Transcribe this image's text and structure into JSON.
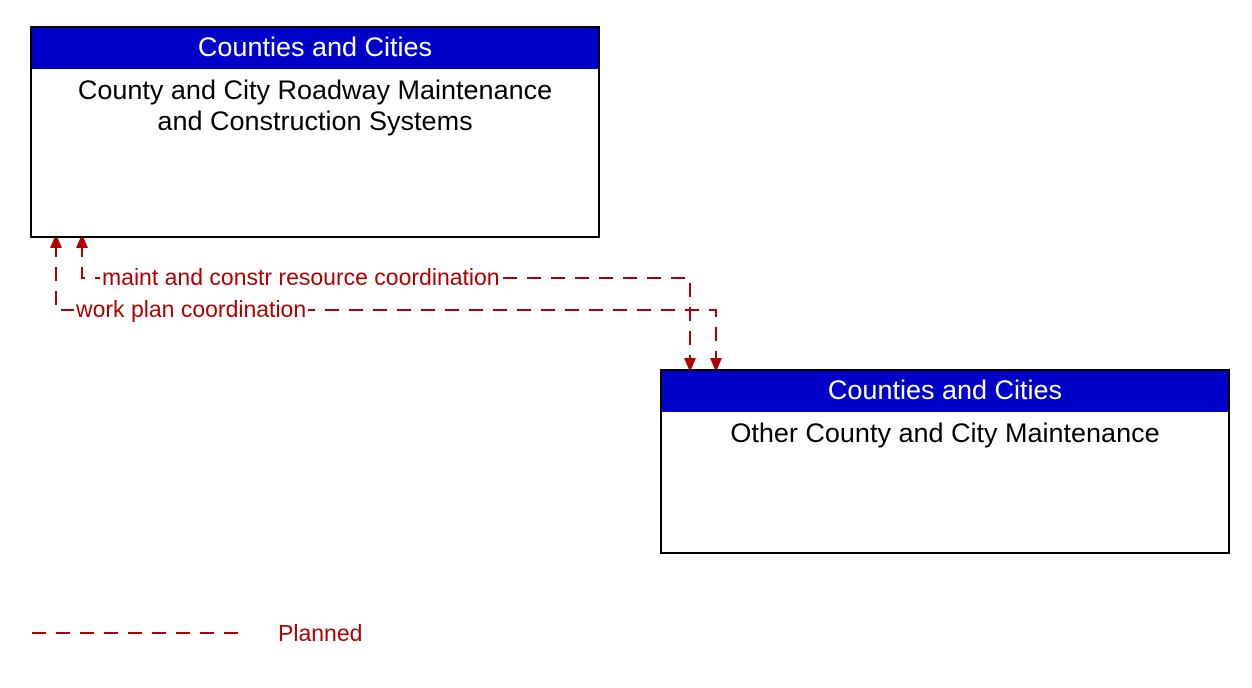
{
  "entities": {
    "top": {
      "header": "Counties and Cities",
      "body": "County and City Roadway Maintenance and Construction Systems"
    },
    "bottom": {
      "header": "Counties and Cities",
      "body": "Other County and City Maintenance"
    }
  },
  "flows": {
    "flow1": "maint and constr resource coordination",
    "flow2": "work plan coordination"
  },
  "legend": {
    "planned": "Planned"
  },
  "chart_data": {
    "type": "diagram",
    "nodes": [
      {
        "id": "n1",
        "group": "Counties and Cities",
        "label": "County and City Roadway Maintenance and Construction Systems"
      },
      {
        "id": "n2",
        "group": "Counties and Cities",
        "label": "Other County and City Maintenance"
      }
    ],
    "edges": [
      {
        "from": "n1",
        "to": "n2",
        "label": "maint and constr resource coordination",
        "status": "Planned",
        "bidirectional": true
      },
      {
        "from": "n1",
        "to": "n2",
        "label": "work plan coordination",
        "status": "Planned",
        "bidirectional": true
      }
    ],
    "legend": [
      {
        "style": "dashed",
        "meaning": "Planned"
      }
    ]
  }
}
